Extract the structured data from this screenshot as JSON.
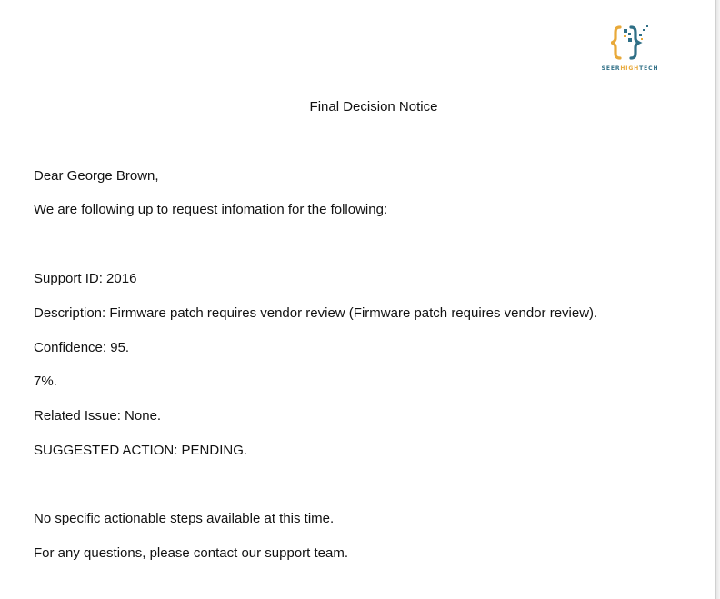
{
  "logo": {
    "name_part1": "SEER",
    "name_part2": "HIGH",
    "name_part3": "TECH",
    "colors": {
      "primary": "#2f6f86",
      "accent": "#e8a93a"
    },
    "icon": "braces-logo-icon"
  },
  "document": {
    "title": "Final Decision Notice",
    "greeting": "Dear George Brown,",
    "intro": "We are following up to request infomation for the following:",
    "support_id": "Support ID: 2016",
    "description": "Description: Firmware patch requires vendor review (Firmware patch requires vendor review).",
    "confidence": "Confidence: 95.",
    "confidence_cont": "7%.",
    "related_issue": "Related Issue: None.",
    "suggested_action": "SUGGESTED ACTION: PENDING.",
    "steps": "No specific actionable steps available at this time.",
    "contact": "For any questions, please contact our support team."
  }
}
